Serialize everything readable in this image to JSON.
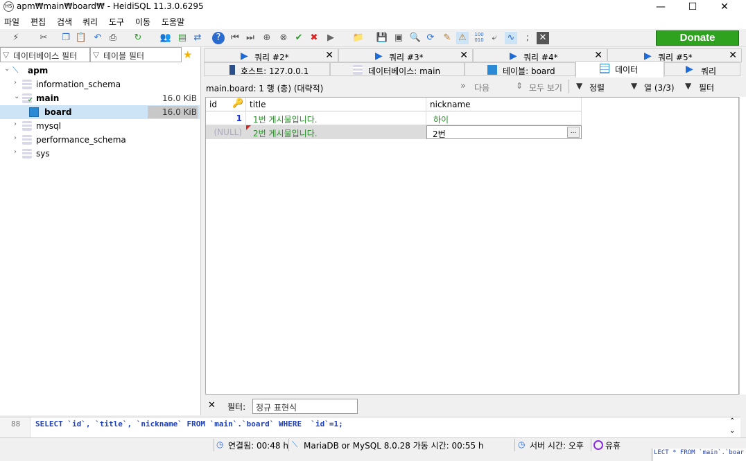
{
  "window": {
    "title": "apm₩main₩board₩ - HeidiSQL 11.3.0.6295",
    "app_icon": "HS"
  },
  "menu": [
    "파일",
    "편집",
    "검색",
    "쿼리",
    "도구",
    "이동",
    "도움말"
  ],
  "toolbar": {
    "donate_label": "Donate"
  },
  "left": {
    "db_filter": "데이터베이스 필터",
    "table_filter": "테이블 필터",
    "tree": [
      {
        "label": "apm",
        "size": ""
      },
      {
        "label": "information_schema",
        "size": ""
      },
      {
        "label": "main",
        "size": "16.0 KiB"
      },
      {
        "label": "board",
        "size": "16.0 KiB"
      },
      {
        "label": "mysql",
        "size": ""
      },
      {
        "label": "performance_schema",
        "size": ""
      },
      {
        "label": "sys",
        "size": ""
      }
    ]
  },
  "query_tabs": [
    "쿼리 #2*",
    "쿼리 #3*",
    "쿼리 #4*",
    "쿼리 #5*"
  ],
  "main_tabs": [
    "호스트: 127.0.0.1",
    "데이터베이스: main",
    "테이블: board",
    "데이터",
    "쿼리"
  ],
  "info": {
    "summary": "main.board: 1 행 (총) (대략적)",
    "next": "다음",
    "show_all": "모두 보기",
    "sort": "정렬",
    "columns": "열 (3/3)",
    "filter": "필터"
  },
  "grid": {
    "columns": [
      "id",
      "title",
      "nickname"
    ],
    "rows": [
      [
        "1",
        "1번 게시물입니다.",
        "하이"
      ],
      [
        "(NULL)",
        "2번 게시물입니다.",
        "2번"
      ]
    ],
    "ellipsis": "..."
  },
  "filter_bar": {
    "close": "✕",
    "label": "필터:",
    "placeholder": "정규 표현식"
  },
  "sql": {
    "line": "88",
    "text": "SELECT `id`, `title`, `nickname` FROM `main`.`board` WHERE  `id`=1;"
  },
  "status": {
    "connected": "연결됨: 00:48 h",
    "server": "MariaDB or MySQL 8.0.28 가동 시간: 00:55 h",
    "server_time": "서버 시간: 오후",
    "idle": "유휴"
  },
  "bg_window_text": "LECT * FROM `main`.`boar"
}
